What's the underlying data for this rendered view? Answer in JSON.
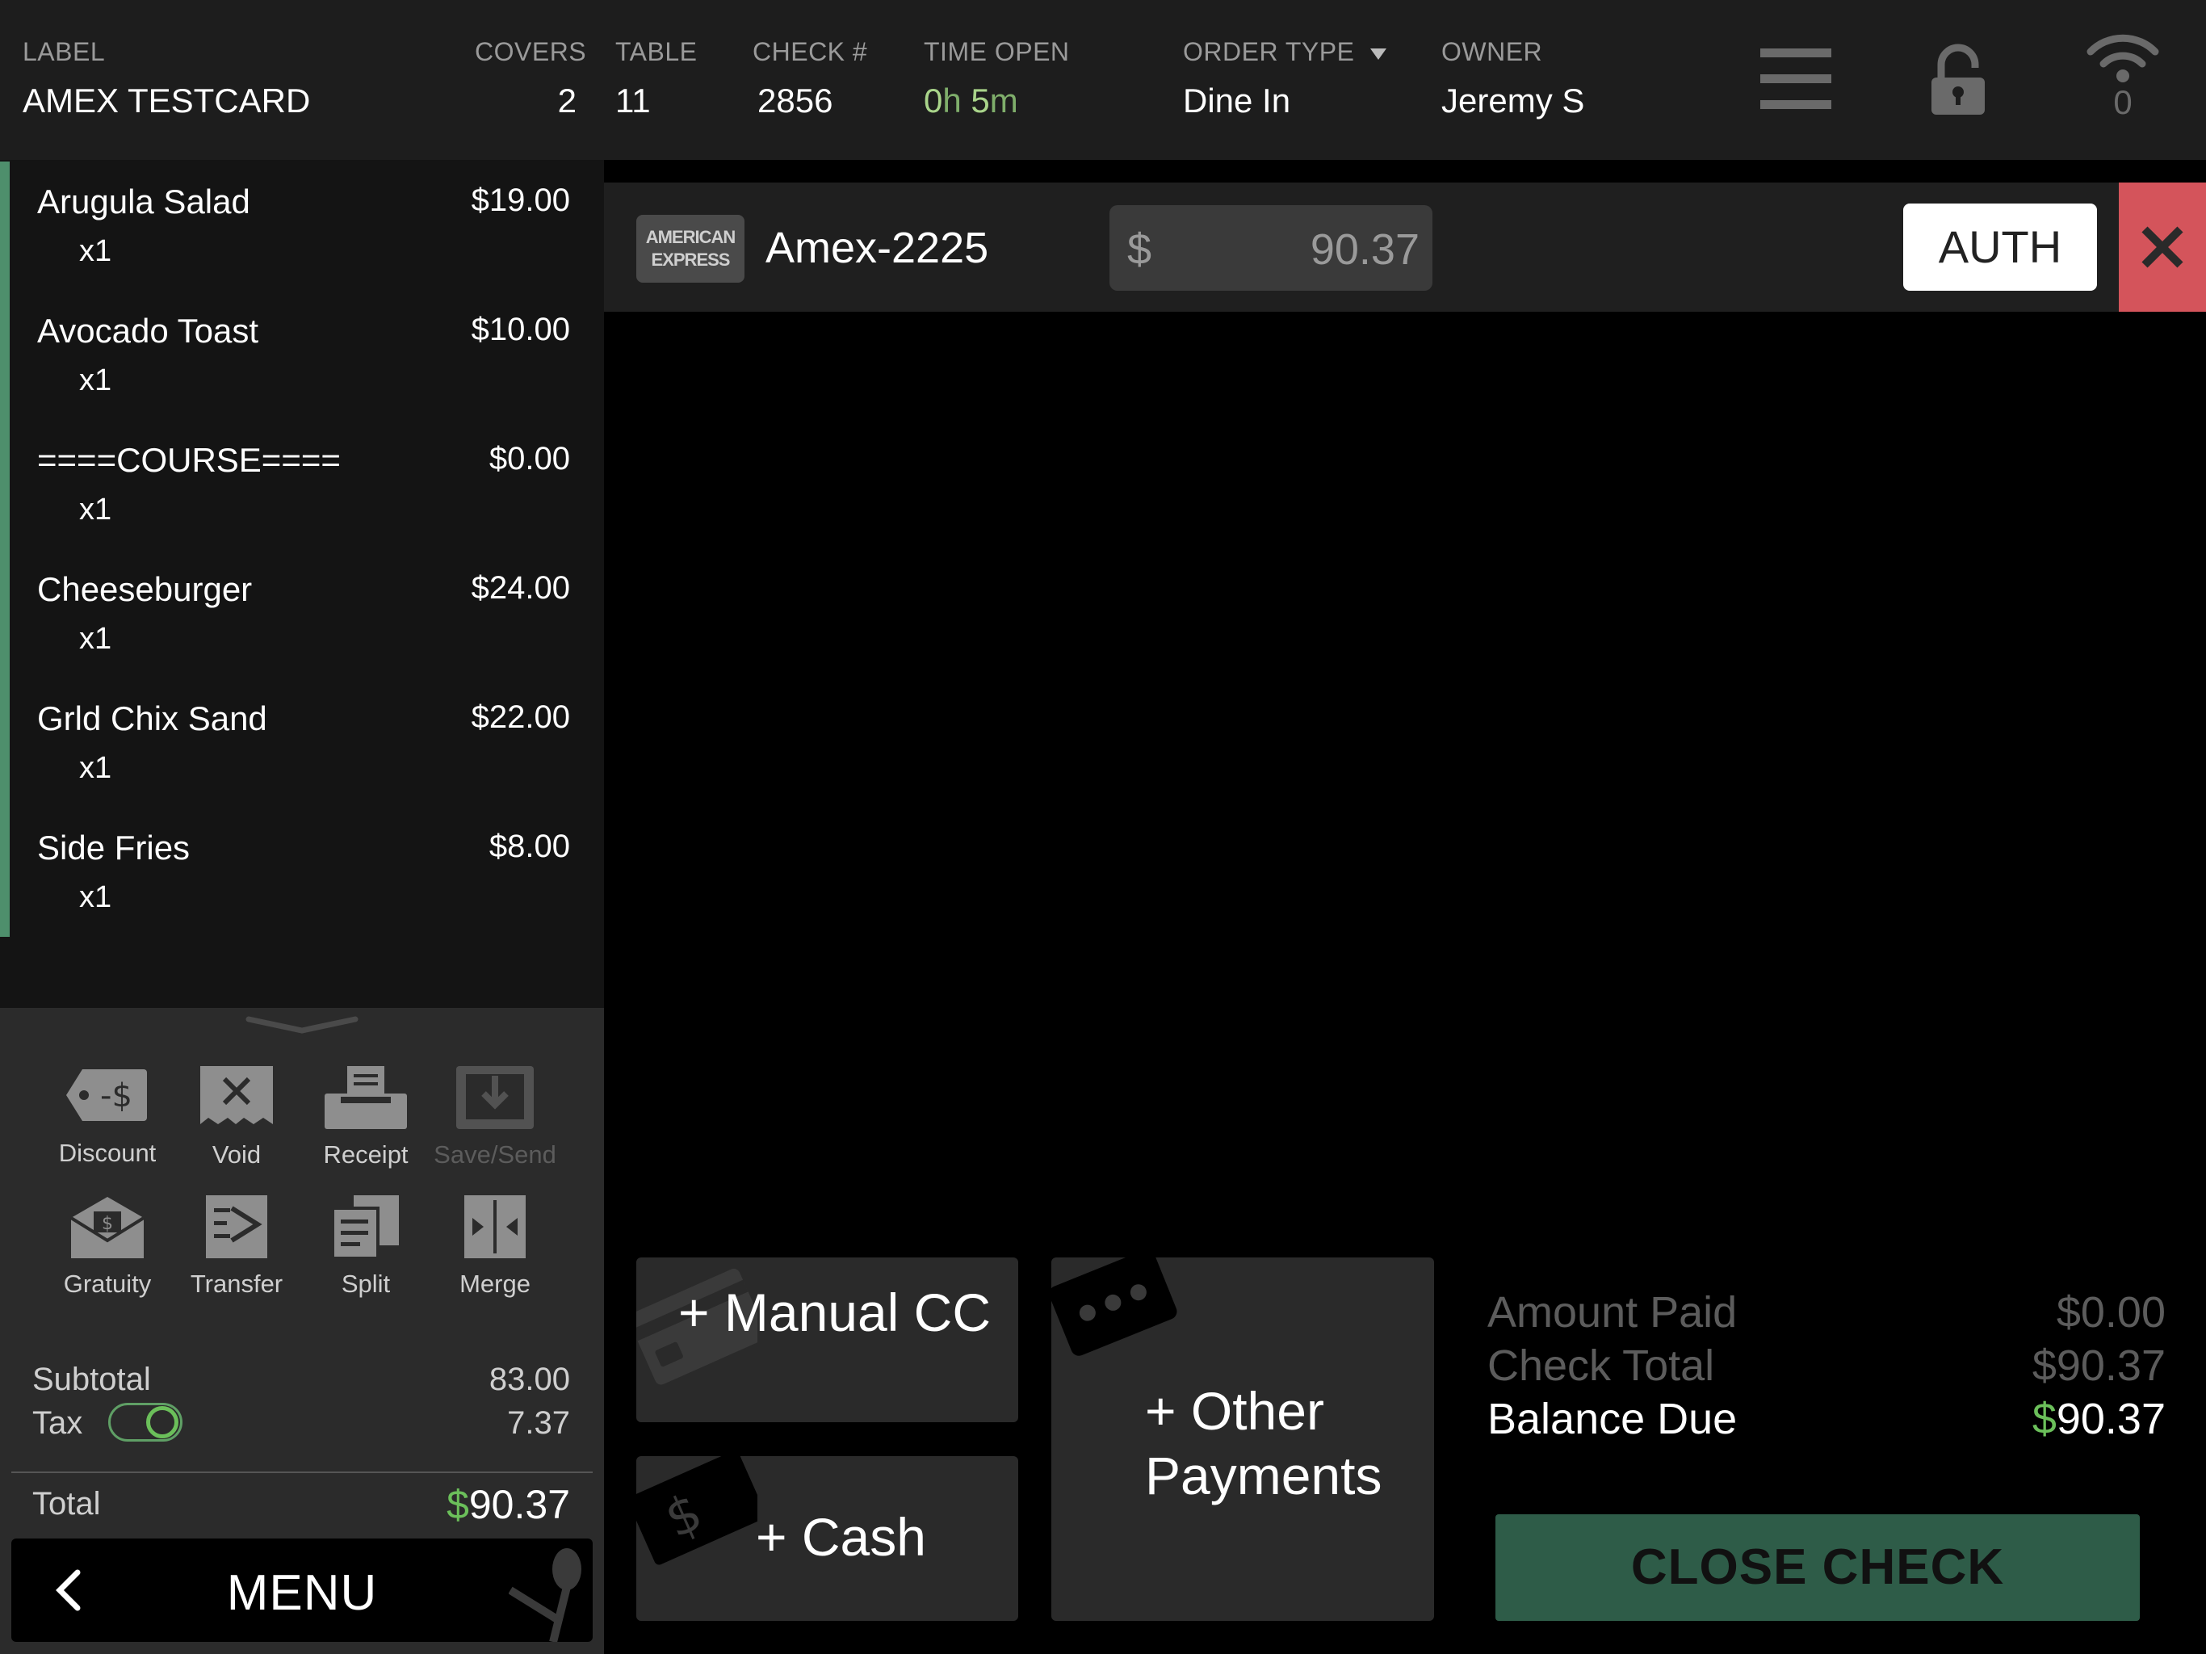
{
  "header": {
    "label": {
      "title": "LABEL",
      "value": "AMEX TESTCARD"
    },
    "covers": {
      "title": "COVERS",
      "value": "2"
    },
    "table": {
      "title": "TABLE",
      "value": "11"
    },
    "check": {
      "title": "CHECK #",
      "value": "2856"
    },
    "time_open": {
      "title": "TIME OPEN",
      "hours": "0",
      "h": "h",
      "minutes": "5",
      "m": "m"
    },
    "order_type": {
      "title": "ORDER TYPE",
      "value": "Dine In"
    },
    "owner": {
      "title": "OWNER",
      "value": "Jeremy S"
    },
    "wifi_count": "0",
    "icons": [
      "hamburger-menu-icon",
      "lock-icon",
      "wifi-icon"
    ]
  },
  "order_items": [
    {
      "name": "Arugula Salad",
      "price": "$19.00",
      "qty": "x1"
    },
    {
      "name": "Avocado Toast",
      "price": "$10.00",
      "qty": "x1"
    },
    {
      "name": "====COURSE====",
      "price": "$0.00",
      "qty": "x1"
    },
    {
      "name": "Cheeseburger",
      "price": "$24.00",
      "qty": "x1"
    },
    {
      "name": "Grld Chix Sand",
      "price": "$22.00",
      "qty": "x1"
    },
    {
      "name": "Side Fries",
      "price": "$8.00",
      "qty": "x1"
    }
  ],
  "tools": [
    {
      "label": "Discount",
      "icon": "discount-tag-icon",
      "enabled": true
    },
    {
      "label": "Void",
      "icon": "void-receipt-icon",
      "enabled": true
    },
    {
      "label": "Receipt",
      "icon": "printer-icon",
      "enabled": true
    },
    {
      "label": "Save/Send",
      "icon": "save-send-icon",
      "enabled": false
    },
    {
      "label": "Gratuity",
      "icon": "gratuity-envelope-icon",
      "enabled": true
    },
    {
      "label": "Transfer",
      "icon": "transfer-icon",
      "enabled": true
    },
    {
      "label": "Split",
      "icon": "split-icon",
      "enabled": true
    },
    {
      "label": "Merge",
      "icon": "merge-icon",
      "enabled": true
    }
  ],
  "summary": {
    "subtotal_label": "Subtotal",
    "subtotal": "83.00",
    "tax_label": "Tax",
    "tax": "7.37",
    "tax_enabled": true,
    "total_label": "Total",
    "total_currency": "$",
    "total": "90.37"
  },
  "menu_button": {
    "label": "MENU"
  },
  "payment": {
    "card_logo_line1": "AMERICAN",
    "card_logo_line2": "EXPRESS",
    "card_name": "Amex-2225",
    "currency": "$",
    "amount": "90.37",
    "auth_label": "AUTH"
  },
  "payment_buttons": {
    "manual_cc": "+ Manual CC",
    "other_line1": "+ Other",
    "other_line2": "Payments",
    "cash": "+ Cash"
  },
  "totals": {
    "amount_paid_label": "Amount Paid",
    "amount_paid": "$0.00",
    "check_total_label": "Check Total",
    "check_total": "$90.37",
    "balance_due_label": "Balance Due",
    "balance_currency": "$",
    "balance_due": "90.37"
  },
  "close_check": "CLOSE CHECK",
  "colors": {
    "accent_green": "#4e8f6c",
    "money_green": "#6bbf5a",
    "close_red": "#d4545b",
    "close_check_bg": "#2e5c48"
  }
}
